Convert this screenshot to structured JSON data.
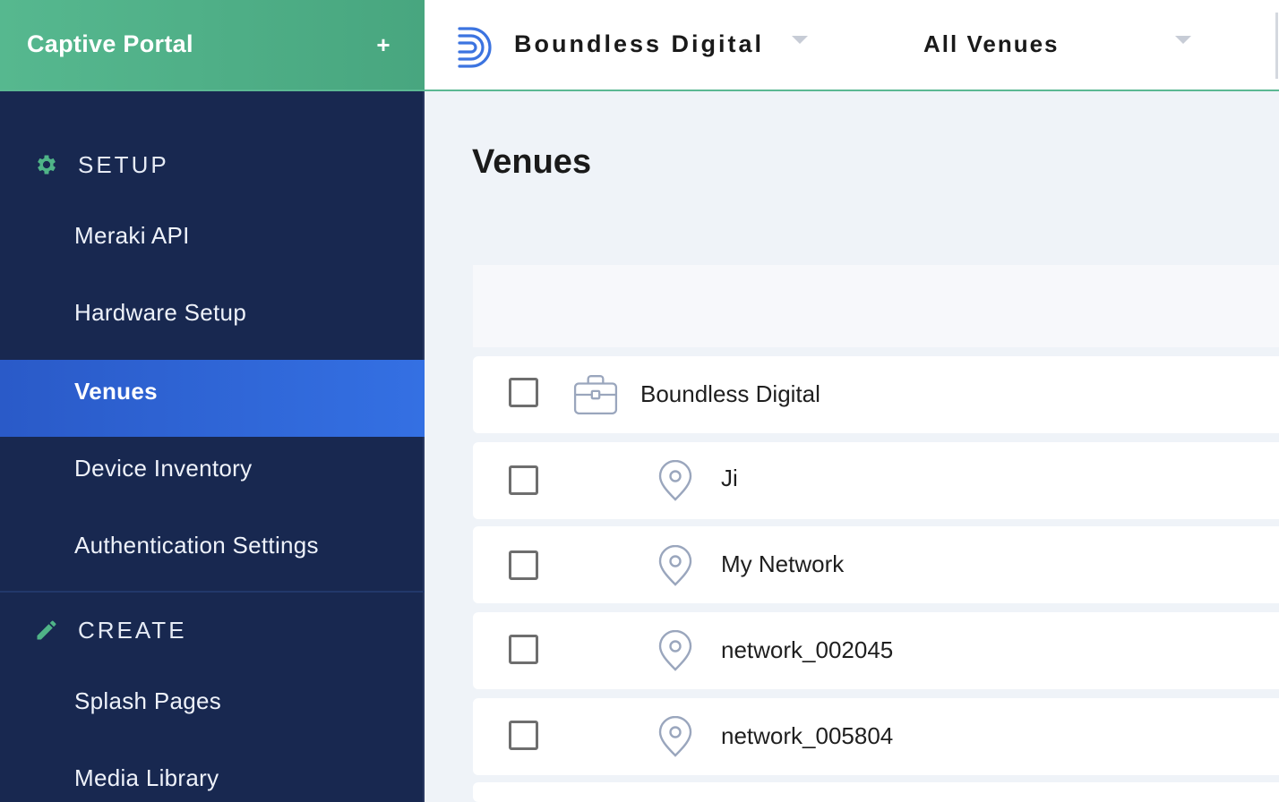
{
  "app": {
    "title": "Captive Portal",
    "add_label": "+"
  },
  "sidebar": {
    "setup": {
      "label": "SETUP",
      "items": [
        "Meraki API",
        "Hardware Setup",
        "Venues",
        "Device Inventory",
        "Authentication Settings"
      ]
    },
    "create": {
      "label": "CREATE",
      "items": [
        "Splash Pages",
        "Media Library"
      ]
    },
    "active_item": "Venues"
  },
  "topbar": {
    "organization": "Boundless Digital",
    "venue_filter": "All Venues"
  },
  "main": {
    "title": "Venues",
    "rows": [
      {
        "name": "Boundless Digital",
        "type": "organization",
        "icon": "briefcase-icon"
      },
      {
        "name": "Ji",
        "type": "venue",
        "icon": "location-pin-icon"
      },
      {
        "name": "My Network",
        "type": "venue",
        "icon": "location-pin-icon"
      },
      {
        "name": "network_002045",
        "type": "venue",
        "icon": "location-pin-icon"
      },
      {
        "name": "network_005804",
        "type": "venue",
        "icon": "location-pin-icon"
      }
    ]
  },
  "colors": {
    "brand_green": "#56b88f",
    "sidebar_bg": "#182850",
    "active_blue": "#3470e3",
    "logo_blue": "#3c74e0",
    "icon_gray": "#9aa6bd"
  }
}
